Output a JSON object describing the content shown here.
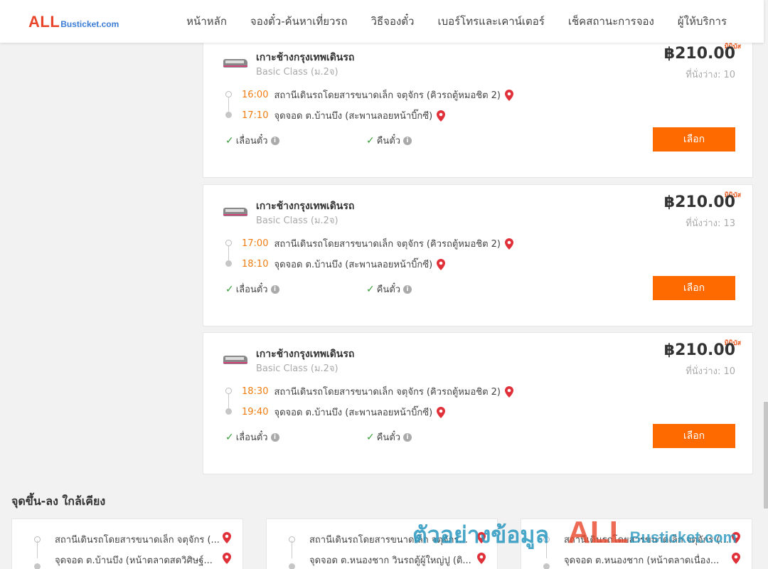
{
  "header": {
    "logo_main": "ALL",
    "logo_sub": "Busticket.com",
    "nav": [
      {
        "label": "หน้าหลัก"
      },
      {
        "label": "จองตั๋ว-ค้นหาเที่ยวรถ"
      },
      {
        "label": "วิธีจองตั๋ว"
      },
      {
        "label": "เบอร์โทรและเคาน์เตอร์"
      },
      {
        "label": "เช็คสถานะการจอง"
      },
      {
        "label": "ผู้ให้บริการ"
      }
    ]
  },
  "trips": [
    {
      "badge": "มินิบัส",
      "route": "เกาะช้างกรุงเทพเดินรถ",
      "class": "Basic Class (ม.2จ)",
      "price": "฿210.00",
      "seats": "ที่นั่งว่าง: 10",
      "depart_time": "16:00",
      "depart_stop": "สถานีเดินรถโดยสารขนาดเล็ก จตุจักร (คิวรถตู้หมอชิต 2)",
      "arrive_time": "17:10",
      "arrive_stop": "จุดจอด ต.บ้านบึง (สะพานลอยหน้าบิ๊กซี)",
      "feature_1": "เลื่อนตั๋ว",
      "feature_2": "คืนตั๋ว",
      "button": "เลือก"
    },
    {
      "badge": "มินิบัส",
      "route": "เกาะช้างกรุงเทพเดินรถ",
      "class": "Basic Class (ม.2จ)",
      "price": "฿210.00",
      "seats": "ที่นั่งว่าง: 13",
      "depart_time": "17:00",
      "depart_stop": "สถานีเดินรถโดยสารขนาดเล็ก จตุจักร (คิวรถตู้หมอชิต 2)",
      "arrive_time": "18:10",
      "arrive_stop": "จุดจอด ต.บ้านบึง (สะพานลอยหน้าบิ๊กซี)",
      "feature_1": "เลื่อนตั๋ว",
      "feature_2": "คืนตั๋ว",
      "button": "เลือก"
    },
    {
      "badge": "มินิบัส",
      "route": "เกาะช้างกรุงเทพเดินรถ",
      "class": "Basic Class (ม.2จ)",
      "price": "฿210.00",
      "seats": "ที่นั่งว่าง: 10",
      "depart_time": "18:30",
      "depart_stop": "สถานีเดินรถโดยสารขนาดเล็ก จตุจักร (คิวรถตู้หมอชิต 2)",
      "arrive_time": "19:40",
      "arrive_stop": "จุดจอด ต.บ้านบึง (สะพานลอยหน้าบิ๊กซี)",
      "feature_1": "เลื่อนตั๋ว",
      "feature_2": "คืนตั๋ว",
      "button": "เลือก"
    }
  ],
  "nearby": {
    "title": "จุดขึ้น-ลง ใกล้เคียง",
    "cards": [
      {
        "from": "สถานีเดินรถโดยสารขนาดเล็ก จตุจักร (...",
        "to": "จุดจอด ต.บ้านบึง (หน้าตลาดสดวิศิษฐ์..."
      },
      {
        "from": "สถานีเดินรถโดยสารขนาดเล็ก จตุจักร...",
        "to": "จุดจอด ต.หนองชาก วินรถตู้ผู้ใหญ่ปู (ติ..."
      },
      {
        "from": "สถานีเดินรถโดยสารขนาดเล็ก จตุจักร (...",
        "to": "จุดจอด ต.หนองชาก (หน้าตลาดเนื่อง..."
      }
    ]
  },
  "watermark": {
    "text": "ตัวอย่างข้อมูล",
    "brand_main": "ALL",
    "brand_sub": "Busticket.com"
  },
  "colors": {
    "accent": "#ff6a00",
    "time": "#f07c10",
    "check": "#3a9b3a",
    "pin": "#e0303a"
  },
  "icons": [
    "bus-icon",
    "map-pin-icon",
    "check-icon",
    "info-icon"
  ]
}
